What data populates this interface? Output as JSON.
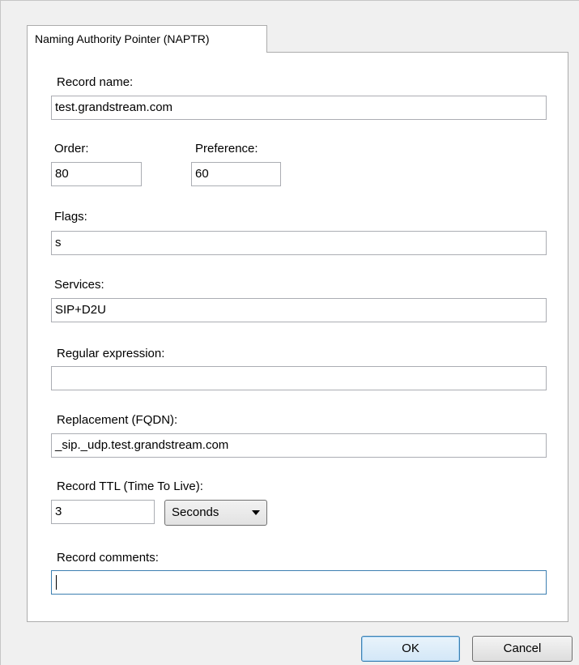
{
  "tab": {
    "label": "Naming Authority Pointer (NAPTR)"
  },
  "fields": {
    "record_name": {
      "label": "Record name:",
      "value": "test.grandstream.com"
    },
    "order": {
      "label": "Order:",
      "value": "80"
    },
    "preference": {
      "label": "Preference:",
      "value": "60"
    },
    "flags": {
      "label": "Flags:",
      "value": "s"
    },
    "services": {
      "label": "Services:",
      "value": "SIP+D2U"
    },
    "regex": {
      "label": "Regular expression:",
      "value": ""
    },
    "replacement": {
      "label": "Replacement (FQDN):",
      "value": "_sip._udp.test.grandstream.com"
    },
    "ttl": {
      "label": "Record TTL (Time To Live):",
      "value": "3",
      "unit": "Seconds"
    },
    "comments": {
      "label": "Record comments:",
      "value": ""
    }
  },
  "buttons": {
    "ok": "OK",
    "cancel": "Cancel"
  },
  "icons": {
    "dropdown": "chevron-down-icon"
  }
}
